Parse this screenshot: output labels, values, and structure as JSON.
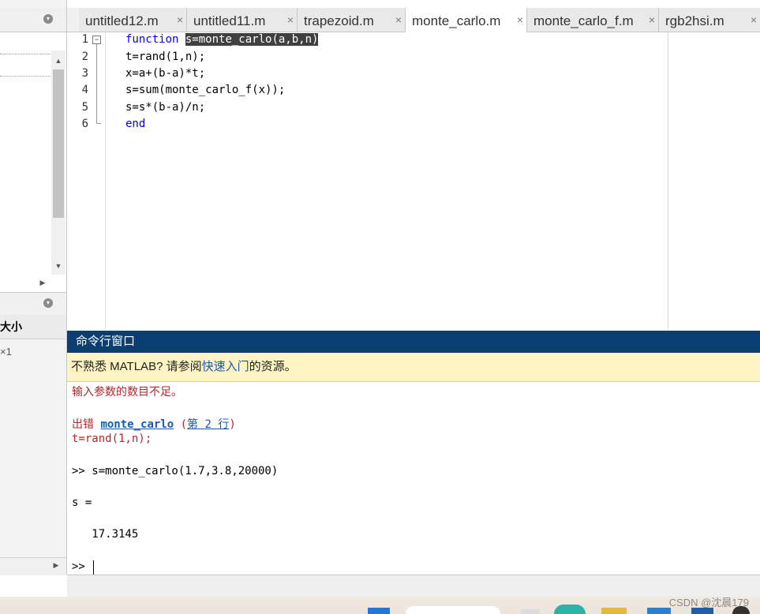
{
  "tabs": [
    {
      "label": "untitled12.m",
      "close": "×",
      "active": false
    },
    {
      "label": "untitled11.m",
      "close": "×",
      "active": false
    },
    {
      "label": "trapezoid.m",
      "close": "×",
      "active": false
    },
    {
      "label": "monte_carlo.m",
      "close": "×",
      "active": true
    },
    {
      "label": "monte_carlo_f.m",
      "close": "×",
      "active": false
    },
    {
      "label": "rgb2hsi.m",
      "close": "×",
      "active": false
    }
  ],
  "editor": {
    "line_numbers": [
      "1",
      "2",
      "3",
      "4",
      "5",
      "6"
    ],
    "fold_symbol": "−",
    "lines": {
      "l1_kw": "function",
      "l1_sel": "s=monte_carlo(a,b,n)",
      "l2": "t=rand(1,n);",
      "l3": "x=a+(b-a)*t;",
      "l4": "s=sum(monte_carlo_f(x));",
      "l5": "s=s*(b-a)/n;",
      "l6_kw": "end"
    }
  },
  "left_panel": {
    "workspace_header": "大小",
    "workspace_row": "×1",
    "up_arrow": "▲",
    "down_arrow": "▼",
    "right_arrow": "▶",
    "right_arrow2": "▶",
    "menu_glyph": "▾"
  },
  "command_window": {
    "title": "命令行窗口",
    "banner_prefix": "不熟悉 MATLAB? 请参阅",
    "banner_link": "快速入门",
    "banner_suffix": "的资源。",
    "error_line": "输入参数的数目不足。",
    "error_prefix": "出错 ",
    "error_func": "monte_carlo",
    "error_paren_open": " (",
    "error_line_link": "第 2 行",
    "error_paren_close": ")",
    "error_code": "t=rand(1,n);",
    "command": ">> s=monte_carlo(1.7,3.8,20000)",
    "result_label": "s =",
    "result_value": "   17.3145",
    "prompt": ">>"
  },
  "watermark": "CSDN @沈晨179",
  "colors": {
    "keyword": "#0000ff",
    "selection_bg": "#404040",
    "cmd_title_bg": "#0b3f73",
    "banner_bg": "#fdf4c3",
    "error": "#b0282b",
    "link": "#1d58a8"
  }
}
